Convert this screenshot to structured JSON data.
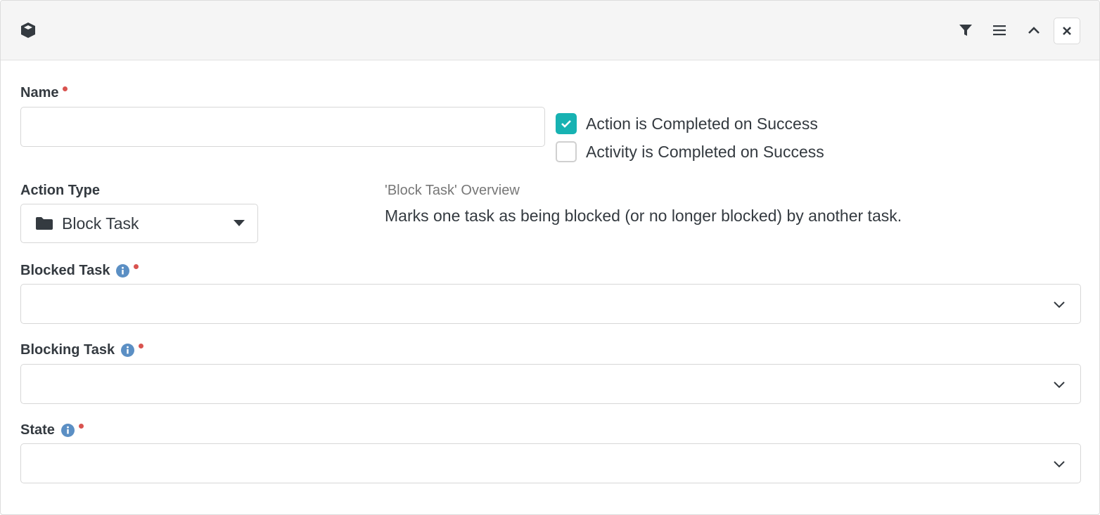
{
  "header": {
    "icons": [
      "cube-icon",
      "filter-icon",
      "menu-icon",
      "chevron-up-icon",
      "close-icon"
    ]
  },
  "form": {
    "name": {
      "label": "Name",
      "value": "",
      "required": true
    },
    "options": [
      {
        "label": "Action is Completed on Success",
        "checked": true
      },
      {
        "label": "Activity is Completed on Success",
        "checked": false
      }
    ],
    "action_type": {
      "label": "Action Type",
      "value": "Block Task",
      "icon": "folder-icon"
    },
    "overview": {
      "title": "'Block Task' Overview",
      "description": "Marks one task as being blocked (or no longer blocked) by another task."
    },
    "blocked_task": {
      "label": "Blocked Task",
      "value": "",
      "required": true
    },
    "blocking_task": {
      "label": "Blocking Task",
      "value": "",
      "required": true
    },
    "state": {
      "label": "State",
      "value": "",
      "required": true
    }
  },
  "colors": {
    "accent": "#17b2b2",
    "required": "#d9534f",
    "info": "#5b8fc4"
  }
}
